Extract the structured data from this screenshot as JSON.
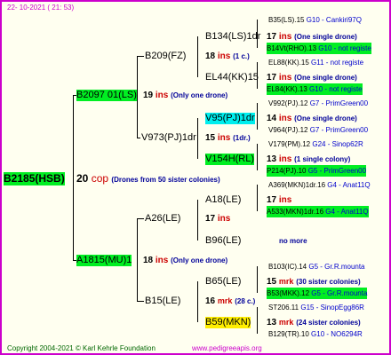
{
  "header": {
    "date": "22- 10-2021 ( 21: 53)"
  },
  "colors": {
    "frame": "#cc00cc",
    "highlight_green": "#00ee22",
    "highlight_cyan": "#00eeee",
    "highlight_yellow": "#ffee00",
    "ins_red": "#cc0000",
    "code_blue": "#0000cc"
  },
  "root": {
    "name": "B2185(HSB)",
    "count": "20",
    "unit": "cop",
    "note": "(Drones from 50 sister colonies)"
  },
  "g1": [
    {
      "name": "B2097 01(LS)",
      "count": "19",
      "unit": "ins",
      "note": "(Only one drone)"
    },
    {
      "name": "A1815(MU)1",
      "count": "18",
      "unit": "ins",
      "note": "(Only one drone)"
    }
  ],
  "g2": [
    {
      "name": "B209(FZ)",
      "count": "18",
      "unit": "ins",
      "note": "(1 c.)"
    },
    {
      "name": "V973(PJ)1dr",
      "count": "15",
      "unit": "ins",
      "note": "(1dr.)"
    },
    {
      "name": "A26(LE)",
      "count": "17",
      "unit": "ins",
      "note": ""
    },
    {
      "name": "B15(LE)",
      "count": "16",
      "unit": "mrk",
      "note": "(28 c.)"
    }
  ],
  "g3": [
    {
      "name": "B134(LS)1dr",
      "count": "17",
      "unit": "ins",
      "note": "(One single drone)"
    },
    {
      "name": "EL44(KK)15",
      "count": "17",
      "unit": "ins",
      "note": "(One single drone)"
    },
    {
      "name": "V95(PJ)1dr",
      "count": "14",
      "unit": "ins",
      "note": "(One single drone)"
    },
    {
      "name": "V154H(RL)",
      "count": "13",
      "unit": "ins",
      "note": "(1 single colony)"
    },
    {
      "name": "A18(LE)",
      "count": "17",
      "unit": "ins",
      "note": ""
    },
    {
      "name": "B96(LE)",
      "count": "",
      "unit": "",
      "note": "no more"
    },
    {
      "name": "B65(LE)",
      "count": "15",
      "unit": "mrk",
      "note": "(30 sister colonies)"
    },
    {
      "name": "B59(MKN)",
      "count": "13",
      "unit": "mrk",
      "note": "(24 sister colonies)"
    }
  ],
  "g4": [
    {
      "name": "B35(LS).15",
      "code": "G10 - Cankiri97Q"
    },
    {
      "name": "B14Vt(RHO).13",
      "code": "G10 - not registe"
    },
    {
      "name": "EL88(KK).15",
      "code": "G11 - not registe"
    },
    {
      "name": "EL84(KK).13",
      "code": "G10 - not registe"
    },
    {
      "name": "V992(PJ).12",
      "code": "G7 - PrimGreen00"
    },
    {
      "name": "V964(PJ).12",
      "code": "G7 - PrimGreen00"
    },
    {
      "name": "V179(PM).12",
      "code": "G24 - Sinop62R"
    },
    {
      "name": "P214(PJ).10",
      "code": "G5 - PrimGreen00"
    },
    {
      "name": "A369(MKN)1dr.16",
      "code": "G4 - Anat11Q"
    },
    {
      "name": "A533(MKN)1dr.16",
      "code": "G4 - Anat11Q"
    },
    {
      "name": "B103(IC).14",
      "code": "G5 - Gr.R.mounta"
    },
    {
      "name": "B53(MKK).12",
      "code": "G5 - Gr.R.mounta"
    },
    {
      "name": "ST206.11",
      "code": "G15 - SinopEgg86R"
    },
    {
      "name": "B129(TR).10",
      "code": "G10 - NO6294R"
    }
  ],
  "footer": {
    "copyright": "Copyright 2004-2021 © Karl Kehrle Foundation",
    "url": "www.pedigreeapis.org"
  }
}
